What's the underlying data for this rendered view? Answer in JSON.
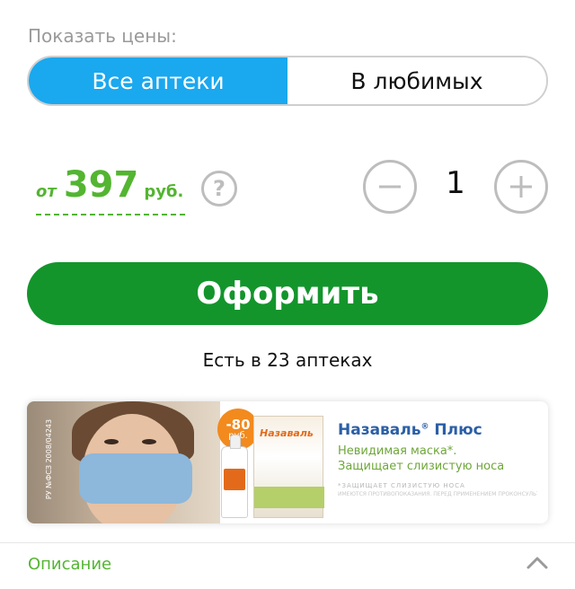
{
  "pricing": {
    "show_prices_label": "Показать цены:",
    "tabs": [
      {
        "label": "Все аптеки",
        "active": true
      },
      {
        "label": "В любимых",
        "active": false
      }
    ]
  },
  "price": {
    "from": "от",
    "amount": "397",
    "currency": "руб."
  },
  "help_icon": "question-mark-icon",
  "quantity": {
    "value": "1",
    "decrement_icon": "minus-icon",
    "increment_icon": "plus-icon"
  },
  "checkout": {
    "label": "Оформить"
  },
  "availability": "Есть в 23 аптеках",
  "banner": {
    "badge_percent": "-80",
    "badge_unit": "руб.",
    "product_name": "Назаваль",
    "product_suffix": "Плюс",
    "registered_mark": "®",
    "line1": "Невидимая маска*.",
    "line2": "Защищает слизистую носа",
    "fine_print1": "*ЗАЩИЩАЕТ СЛИЗИСТУЮ НОСА",
    "fine_print2": "ИМЕЮТСЯ ПРОТИВОПОКАЗАНИЯ. ПЕРЕД ПРИМЕНЕНИЕМ ПРОКОНСУЛЬТИРУЙТЕСЬ СО СПЕЦИАЛИСТОМ",
    "reg_code": "РУ №ФСЗ 2008/04243",
    "box_brand": "Назаваль"
  },
  "description": {
    "label": "Описание",
    "chevron_icon": "chevron-up-icon"
  },
  "colors": {
    "accent_blue": "#1aa8ef",
    "price_green": "#53b531",
    "checkout_green": "#13952c",
    "muted_gray": "#bdbdbd"
  }
}
